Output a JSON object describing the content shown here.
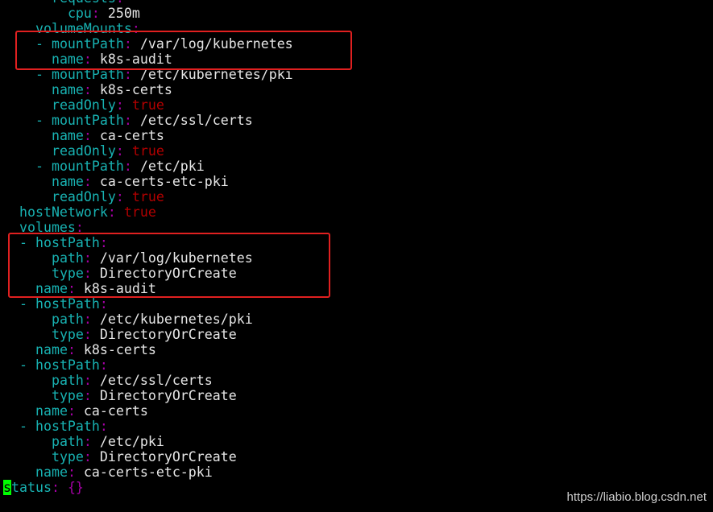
{
  "lines": [
    [
      {
        "t": "      ",
        "c": "v"
      },
      {
        "t": "requests",
        "c": "k"
      },
      {
        "t": ":",
        "c": "p"
      }
    ],
    [
      {
        "t": "        ",
        "c": "v"
      },
      {
        "t": "cpu",
        "c": "k"
      },
      {
        "t": ": ",
        "c": "p"
      },
      {
        "t": "250m",
        "c": "v"
      }
    ],
    [
      {
        "t": "    ",
        "c": "v"
      },
      {
        "t": "volumeMounts",
        "c": "k"
      },
      {
        "t": ":",
        "c": "p"
      }
    ],
    [
      {
        "t": "    ",
        "c": "v"
      },
      {
        "t": "- ",
        "c": "d"
      },
      {
        "t": "mountPath",
        "c": "k"
      },
      {
        "t": ": ",
        "c": "p"
      },
      {
        "t": "/var/log/kubernetes",
        "c": "v"
      }
    ],
    [
      {
        "t": "      ",
        "c": "v"
      },
      {
        "t": "name",
        "c": "k"
      },
      {
        "t": ": ",
        "c": "p"
      },
      {
        "t": "k8s-audit",
        "c": "v"
      }
    ],
    [
      {
        "t": "    ",
        "c": "v"
      },
      {
        "t": "- ",
        "c": "d"
      },
      {
        "t": "mountPath",
        "c": "k"
      },
      {
        "t": ": ",
        "c": "p"
      },
      {
        "t": "/etc/kubernetes/pki",
        "c": "v"
      }
    ],
    [
      {
        "t": "      ",
        "c": "v"
      },
      {
        "t": "name",
        "c": "k"
      },
      {
        "t": ": ",
        "c": "p"
      },
      {
        "t": "k8s-certs",
        "c": "v"
      }
    ],
    [
      {
        "t": "      ",
        "c": "v"
      },
      {
        "t": "readOnly",
        "c": "k"
      },
      {
        "t": ": ",
        "c": "p"
      },
      {
        "t": "true",
        "c": "b"
      }
    ],
    [
      {
        "t": "    ",
        "c": "v"
      },
      {
        "t": "- ",
        "c": "d"
      },
      {
        "t": "mountPath",
        "c": "k"
      },
      {
        "t": ": ",
        "c": "p"
      },
      {
        "t": "/etc/ssl/certs",
        "c": "v"
      }
    ],
    [
      {
        "t": "      ",
        "c": "v"
      },
      {
        "t": "name",
        "c": "k"
      },
      {
        "t": ": ",
        "c": "p"
      },
      {
        "t": "ca-certs",
        "c": "v"
      }
    ],
    [
      {
        "t": "      ",
        "c": "v"
      },
      {
        "t": "readOnly",
        "c": "k"
      },
      {
        "t": ": ",
        "c": "p"
      },
      {
        "t": "true",
        "c": "b"
      }
    ],
    [
      {
        "t": "    ",
        "c": "v"
      },
      {
        "t": "- ",
        "c": "d"
      },
      {
        "t": "mountPath",
        "c": "k"
      },
      {
        "t": ": ",
        "c": "p"
      },
      {
        "t": "/etc/pki",
        "c": "v"
      }
    ],
    [
      {
        "t": "      ",
        "c": "v"
      },
      {
        "t": "name",
        "c": "k"
      },
      {
        "t": ": ",
        "c": "p"
      },
      {
        "t": "ca-certs-etc-pki",
        "c": "v"
      }
    ],
    [
      {
        "t": "      ",
        "c": "v"
      },
      {
        "t": "readOnly",
        "c": "k"
      },
      {
        "t": ": ",
        "c": "p"
      },
      {
        "t": "true",
        "c": "b"
      }
    ],
    [
      {
        "t": "  ",
        "c": "v"
      },
      {
        "t": "hostNetwork",
        "c": "k"
      },
      {
        "t": ": ",
        "c": "p"
      },
      {
        "t": "true",
        "c": "b"
      }
    ],
    [
      {
        "t": "  ",
        "c": "v"
      },
      {
        "t": "volumes",
        "c": "k"
      },
      {
        "t": ":",
        "c": "p"
      }
    ],
    [
      {
        "t": "  ",
        "c": "v"
      },
      {
        "t": "- ",
        "c": "d"
      },
      {
        "t": "hostPath",
        "c": "k"
      },
      {
        "t": ":",
        "c": "p"
      }
    ],
    [
      {
        "t": "      ",
        "c": "v"
      },
      {
        "t": "path",
        "c": "k"
      },
      {
        "t": ": ",
        "c": "p"
      },
      {
        "t": "/var/log/kubernetes",
        "c": "v"
      }
    ],
    [
      {
        "t": "      ",
        "c": "v"
      },
      {
        "t": "type",
        "c": "k"
      },
      {
        "t": ": ",
        "c": "p"
      },
      {
        "t": "DirectoryOrCreate",
        "c": "v"
      }
    ],
    [
      {
        "t": "    ",
        "c": "v"
      },
      {
        "t": "name",
        "c": "k"
      },
      {
        "t": ": ",
        "c": "p"
      },
      {
        "t": "k8s-audit",
        "c": "v"
      }
    ],
    [
      {
        "t": "  ",
        "c": "v"
      },
      {
        "t": "- ",
        "c": "d"
      },
      {
        "t": "hostPath",
        "c": "k"
      },
      {
        "t": ":",
        "c": "p"
      }
    ],
    [
      {
        "t": "      ",
        "c": "v"
      },
      {
        "t": "path",
        "c": "k"
      },
      {
        "t": ": ",
        "c": "p"
      },
      {
        "t": "/etc/kubernetes/pki",
        "c": "v"
      }
    ],
    [
      {
        "t": "      ",
        "c": "v"
      },
      {
        "t": "type",
        "c": "k"
      },
      {
        "t": ": ",
        "c": "p"
      },
      {
        "t": "DirectoryOrCreate",
        "c": "v"
      }
    ],
    [
      {
        "t": "    ",
        "c": "v"
      },
      {
        "t": "name",
        "c": "k"
      },
      {
        "t": ": ",
        "c": "p"
      },
      {
        "t": "k8s-certs",
        "c": "v"
      }
    ],
    [
      {
        "t": "  ",
        "c": "v"
      },
      {
        "t": "- ",
        "c": "d"
      },
      {
        "t": "hostPath",
        "c": "k"
      },
      {
        "t": ":",
        "c": "p"
      }
    ],
    [
      {
        "t": "      ",
        "c": "v"
      },
      {
        "t": "path",
        "c": "k"
      },
      {
        "t": ": ",
        "c": "p"
      },
      {
        "t": "/etc/ssl/certs",
        "c": "v"
      }
    ],
    [
      {
        "t": "      ",
        "c": "v"
      },
      {
        "t": "type",
        "c": "k"
      },
      {
        "t": ": ",
        "c": "p"
      },
      {
        "t": "DirectoryOrCreate",
        "c": "v"
      }
    ],
    [
      {
        "t": "    ",
        "c": "v"
      },
      {
        "t": "name",
        "c": "k"
      },
      {
        "t": ": ",
        "c": "p"
      },
      {
        "t": "ca-certs",
        "c": "v"
      }
    ],
    [
      {
        "t": "  ",
        "c": "v"
      },
      {
        "t": "- ",
        "c": "d"
      },
      {
        "t": "hostPath",
        "c": "k"
      },
      {
        "t": ":",
        "c": "p"
      }
    ],
    [
      {
        "t": "      ",
        "c": "v"
      },
      {
        "t": "path",
        "c": "k"
      },
      {
        "t": ": ",
        "c": "p"
      },
      {
        "t": "/etc/pki",
        "c": "v"
      }
    ],
    [
      {
        "t": "      ",
        "c": "v"
      },
      {
        "t": "type",
        "c": "k"
      },
      {
        "t": ": ",
        "c": "p"
      },
      {
        "t": "DirectoryOrCreate",
        "c": "v"
      }
    ],
    [
      {
        "t": "    ",
        "c": "v"
      },
      {
        "t": "name",
        "c": "k"
      },
      {
        "t": ": ",
        "c": "p"
      },
      {
        "t": "ca-certs-etc-pki",
        "c": "v"
      }
    ],
    [
      {
        "t": "s",
        "c": "cursor"
      },
      {
        "t": "tatus",
        "c": "k"
      },
      {
        "t": ": ",
        "c": "p"
      },
      {
        "t": "{}",
        "c": "p"
      }
    ]
  ],
  "watermark": "https://liabio.blog.csdn.net",
  "colors": {
    "background": "#000000",
    "key": "#18b2b2",
    "value": "#e6e6e6",
    "punct": "#a600a6",
    "bool": "#b20000",
    "cursor": "#00ff00",
    "highlight": "#e02020"
  }
}
